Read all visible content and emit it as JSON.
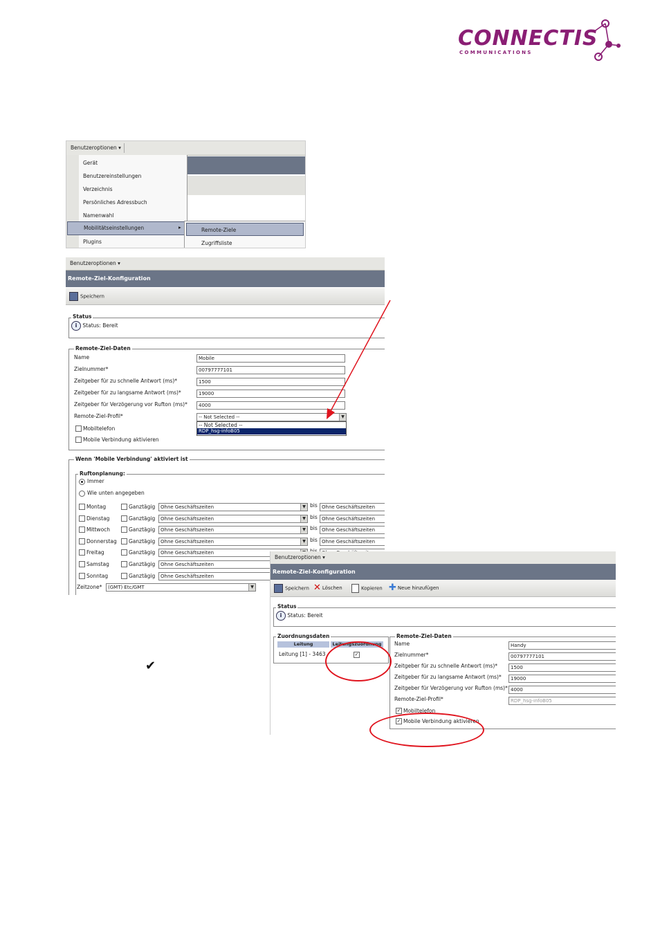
{
  "logo": {
    "word": "CONNECTIS",
    "sub": "COMMUNICATIONS"
  },
  "colors": {
    "brand": "#8a1e74",
    "header": "#6b7587",
    "selection": "#0a246a",
    "highlight": "#e0141e"
  },
  "shot1": {
    "menu": "Benutzeroptionen",
    "items": [
      "Gerät",
      "Benutzereinstellungen",
      "Verzeichnis",
      "Persönliches Adressbuch",
      "Namenwahl",
      "Mobilitätseinstellungen",
      "Plugins"
    ],
    "submenu": [
      "Remote-Ziele",
      "Zugriffsliste"
    ]
  },
  "shot2": {
    "menu": "Benutzeroptionen",
    "title": "Remote-Ziel-Konfiguration",
    "save": "Speichern",
    "status_legend": "Status",
    "status_text": "Status: Bereit",
    "data_legend": "Remote-Ziel-Daten",
    "labels": {
      "name": "Name",
      "number": "Zielnummer*",
      "fast": "Zeitgeber für zu schnelle Antwort (ms)*",
      "slow": "Zeitgeber für zu langsame Antwort (ms)*",
      "delay": "Zeitgeber für Verzögerung vor Rufton (ms)*",
      "profile": "Remote-Ziel-Profil*",
      "mobile": "Mobiltelefon",
      "enable": "Mobile Verbindung aktivieren"
    },
    "values": {
      "name": "Mobile",
      "number": "00797777101",
      "fast": "1500",
      "slow": "19000",
      "delay": "4000",
      "profile": "-- Not Selected --"
    },
    "dropdown": [
      "-- Not Selected --",
      "RDP_hsg-infoB05"
    ],
    "when_legend": "Wenn 'Mobile Verbindung' aktiviert ist",
    "ring_legend": "Ruftonplanung:",
    "radio_always": "Immer",
    "radio_below": "Wie unten angegeben",
    "days": [
      "Montag",
      "Dienstag",
      "Mittwoch",
      "Donnerstag",
      "Freitag",
      "Samstag",
      "Sonntag"
    ],
    "allday": "Ganztägig",
    "hours": "Ohne Geschäftszeiten",
    "bis": "bis",
    "tz_label": "Zeitzone*",
    "tz_value": "(GMT) Etc/GMT"
  },
  "shot3": {
    "menu": "Benutzeroptionen",
    "title": "Remote-Ziel-Konfiguration",
    "tools": [
      "Speichern",
      "Löschen",
      "Kopieren",
      "Neue hinzufügen"
    ],
    "status_legend": "Status",
    "status_text": "Status: Bereit",
    "assign_legend": "Zuordnungsdaten",
    "col1": "Leitung",
    "col2": "Leitungszuordnung",
    "line": "Leitung [1] - 3463",
    "data_legend": "Remote-Ziel-Daten",
    "labels": {
      "name": "Name",
      "number": "Zielnummer*",
      "fast": "Zeitgeber für zu schnelle Antwort (ms)*",
      "slow": "Zeitgeber für zu langsame Antwort (ms)*",
      "delay": "Zeitgeber für Verzögerung vor Rufton (ms)*",
      "profile": "Remote-Ziel-Profil*",
      "mobile": "Mobiltelefon",
      "enable": "Mobile Verbindung aktivieren"
    },
    "values": {
      "name": "Handy",
      "number": "00797777101",
      "fast": "1500",
      "slow": "19000",
      "delay": "4000",
      "profile": "RDP_hsg-infoB05"
    }
  },
  "checkmark": "✔"
}
